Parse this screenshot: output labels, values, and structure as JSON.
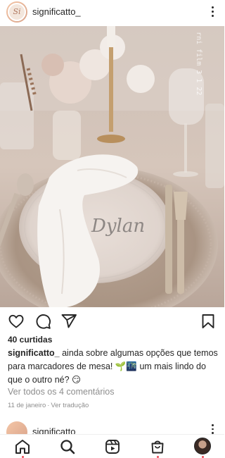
{
  "post": {
    "username": "significatto_",
    "avatar_initials": "Si",
    "likes": "40 curtidas",
    "caption_user": "significatto_",
    "caption_text": " ainda sobre algumas opções que temos para marcadores de mesa! 🌱🌃 um mais lindo do que o outro né? 😏",
    "view_comments": "Ver todos os 4 comentários",
    "date": "11 de janeiro",
    "translate": "Ver tradução",
    "photo": {
      "place_card_name": "Dylan",
      "watermark": "rni film 3 1 22"
    }
  },
  "next_post": {
    "username": "significatto_"
  },
  "icons": {
    "like": "heart-icon",
    "comment": "comment-icon",
    "share": "send-icon",
    "save": "bookmark-icon",
    "more": "kebab-menu-icon"
  },
  "nav": {
    "items": [
      "home-icon",
      "search-icon",
      "reels-icon",
      "shop-icon",
      "profile-avatar"
    ],
    "notification_color": "#ed4956"
  }
}
